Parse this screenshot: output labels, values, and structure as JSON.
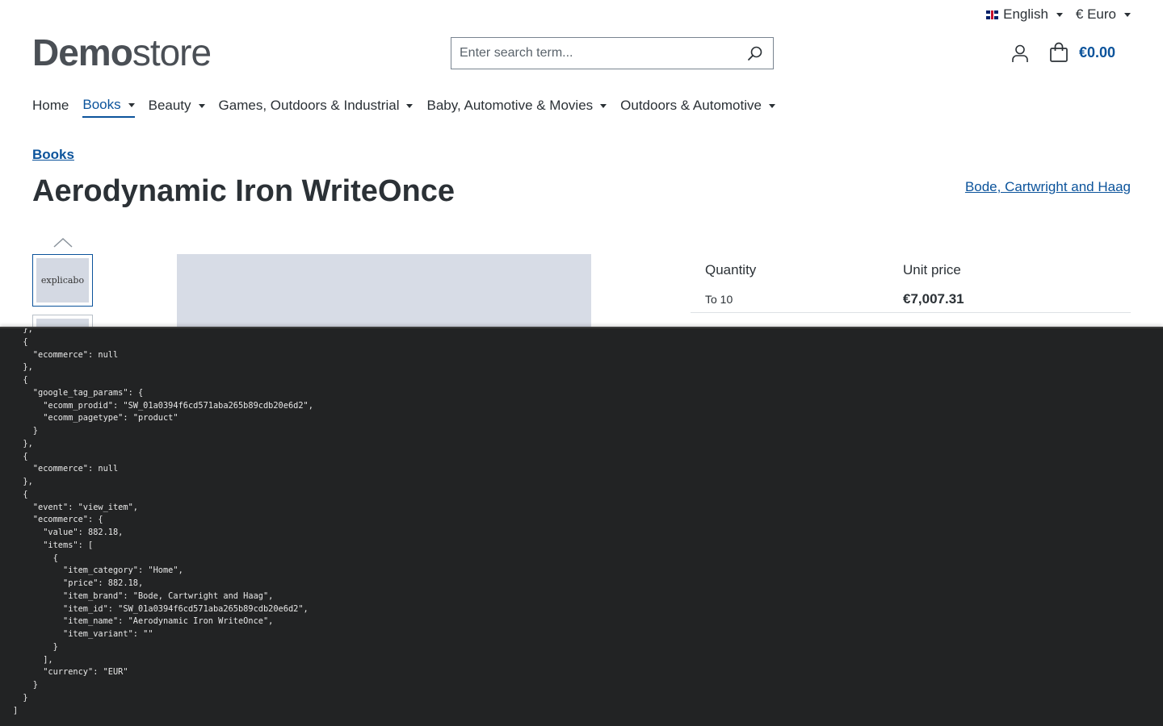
{
  "topbar": {
    "language": {
      "label": "English",
      "icon": "uk-flag-icon"
    },
    "currency": {
      "label": "€ Euro"
    }
  },
  "logo": {
    "bold": "Demo",
    "light": "store"
  },
  "search": {
    "placeholder": "Enter search term..."
  },
  "cart": {
    "amount": "€0.00"
  },
  "nav": {
    "items": [
      {
        "label": "Home"
      },
      {
        "label": "Books"
      },
      {
        "label": "Beauty"
      },
      {
        "label": "Games, Outdoors & Industrial"
      },
      {
        "label": "Baby, Automotive & Movies"
      },
      {
        "label": "Outdoors & Automotive"
      }
    ]
  },
  "breadcrumb": "Books",
  "product": {
    "title": "Aerodynamic Iron WriteOnce",
    "manufacturer": "Bode, Cartwright and Haag",
    "thumbnail_text": "explicabo"
  },
  "price_table": {
    "headers": [
      "Quantity",
      "Unit price"
    ],
    "rows": [
      {
        "qty": "To 10",
        "price": "€7,007.31"
      }
    ]
  },
  "console": {
    "text": "  },\n  {\n    \"ecommerce\": null\n  },\n  {\n    \"google_tag_params\": {\n      \"ecomm_prodid\": \"SW_01a0394f6cd571aba265b89cdb20e6d2\",\n      \"ecomm_pagetype\": \"product\"\n    }\n  },\n  {\n    \"ecommerce\": null\n  },\n  {\n    \"event\": \"view_item\",\n    \"ecommerce\": {\n      \"value\": 882.18,\n      \"items\": [\n        {\n          \"item_category\": \"Home\",\n          \"price\": 882.18,\n          \"item_brand\": \"Bode, Cartwright and Haag\",\n          \"item_id\": \"SW_01a0394f6cd571aba265b89cdb20e6d2\",\n          \"item_name\": \"Aerodynamic Iron WriteOnce\",\n          \"item_variant\": \"\"\n        }\n      ],\n      \"currency\": \"EUR\"\n    }\n  }\n]"
  },
  "colors": {
    "accent": "#0b539b",
    "text": "#2b3136",
    "console_bg": "#222324"
  }
}
